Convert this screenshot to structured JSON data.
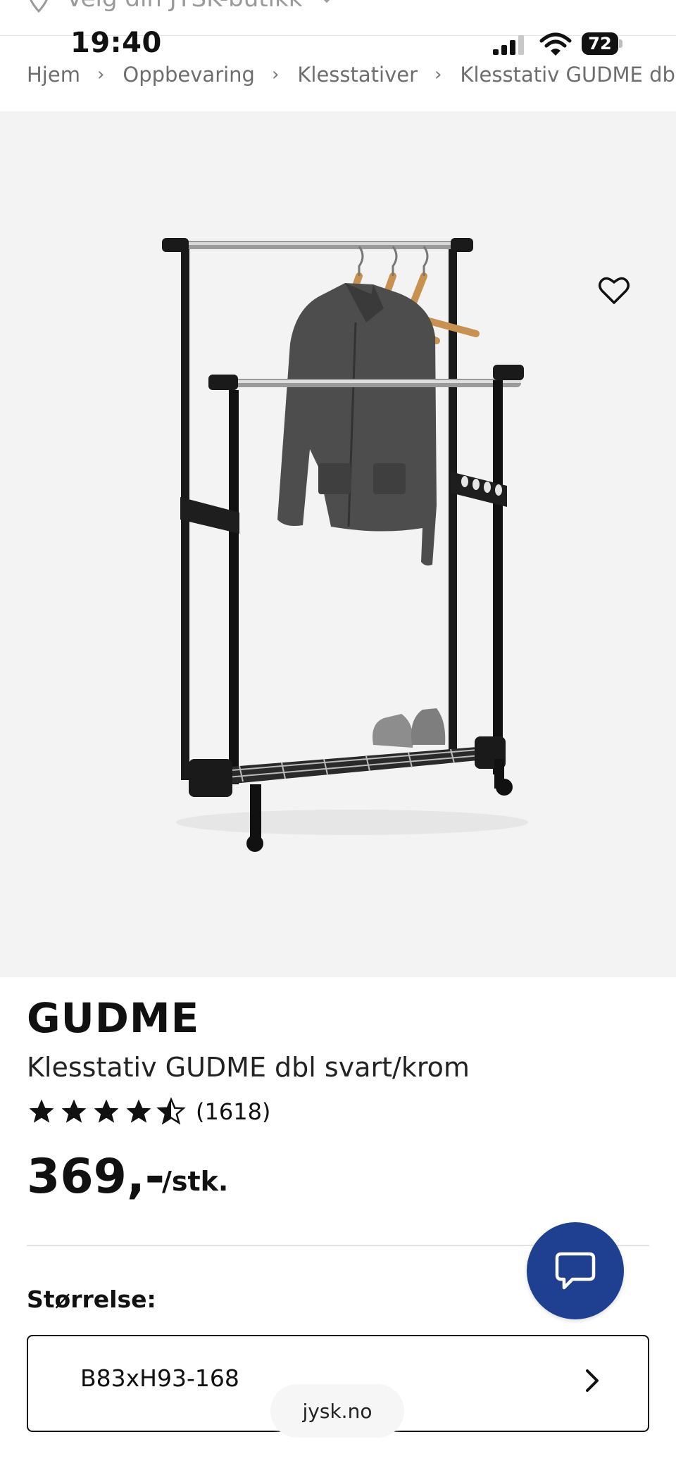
{
  "header": {
    "store_selector": "Velg din JYSK-butikk",
    "pin_icon": "location-pin-icon",
    "dropdown_icon": "chevron-down-icon"
  },
  "status_bar": {
    "time": "19:40",
    "battery": "72"
  },
  "breadcrumb": [
    "Hjem",
    "Oppbevaring",
    "Klesstativer",
    "Klesstativ GUDME dbl svart/krom"
  ],
  "gallery": {
    "image_count": 2,
    "active_index": 0,
    "favorite_icon": "heart-outline-icon"
  },
  "product": {
    "brand": "GUDME",
    "name": "Klesstativ GUDME dbl svart/krom",
    "rating": 4.5,
    "rating_max": 5,
    "review_count": "(1618)",
    "price": "369,-",
    "unit": "/stk."
  },
  "size": {
    "label": "Størrelse:",
    "value": "B83xH93-168"
  },
  "chat": {
    "icon": "chat-bubble-icon"
  },
  "url_bar": {
    "domain": "jysk.no"
  },
  "colors": {
    "accent": "#1f3f91",
    "image_background": "#f3f3f3",
    "text": "#111111"
  }
}
